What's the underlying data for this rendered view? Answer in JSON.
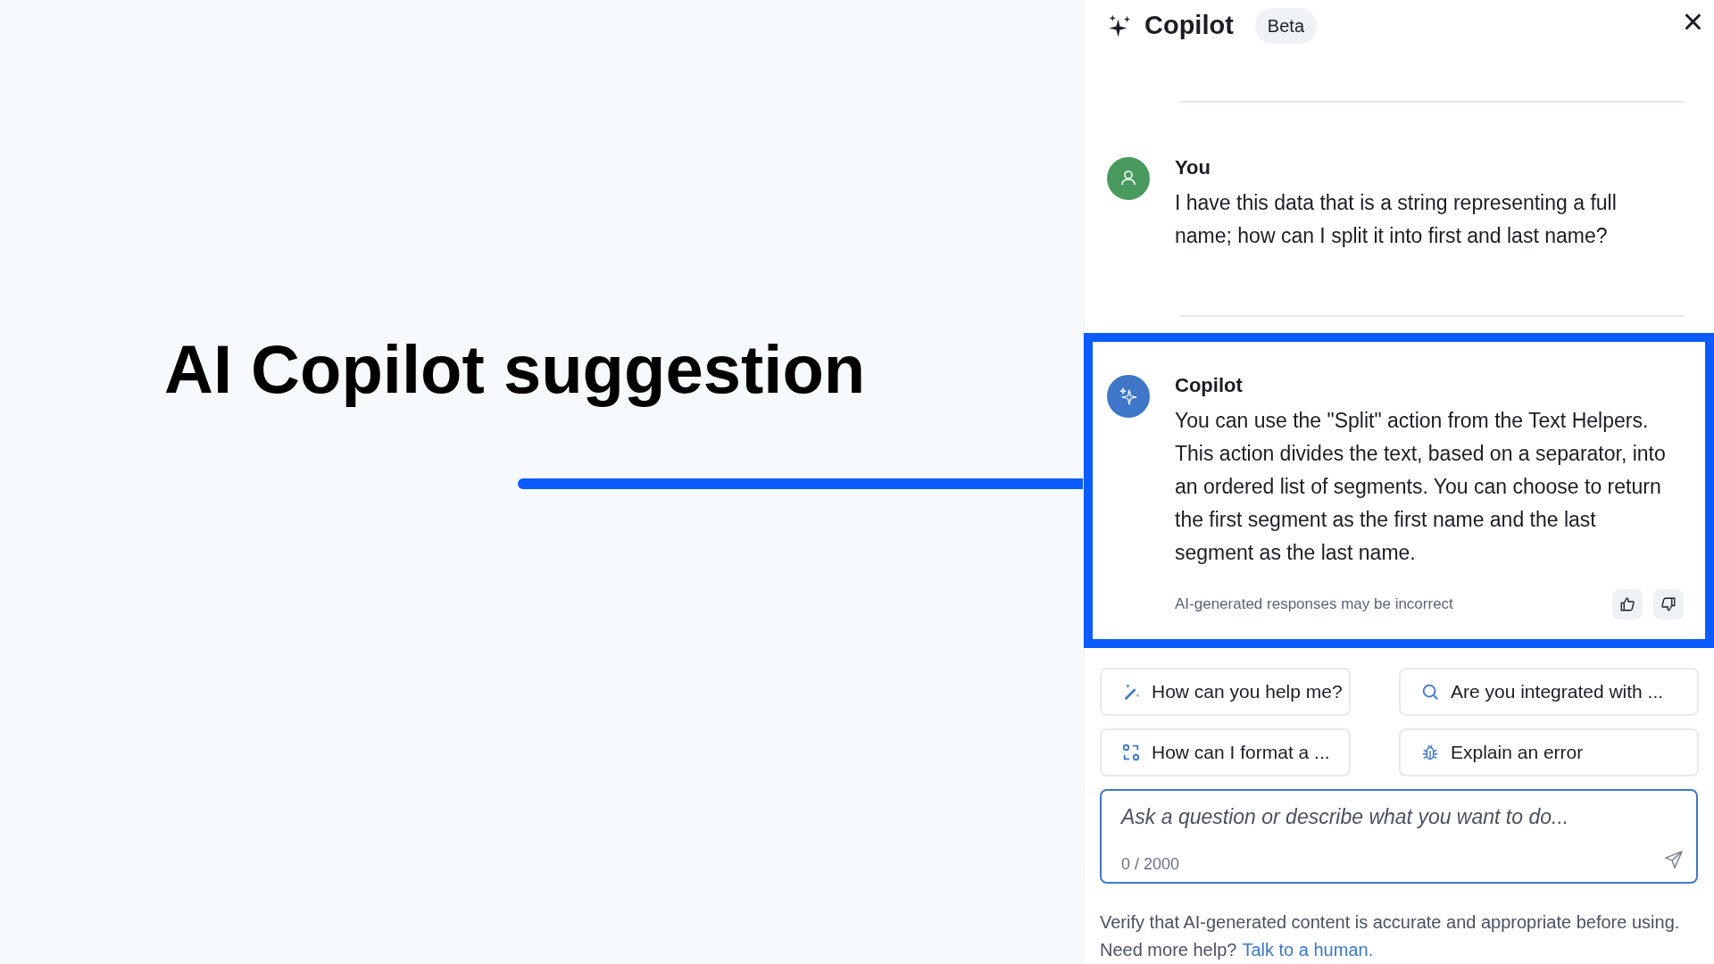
{
  "annotation": {
    "heading": "AI Copilot suggestion"
  },
  "panel": {
    "title": "Copilot",
    "badge": "Beta",
    "close": "×"
  },
  "messages": [
    {
      "kind": "user",
      "author": "You",
      "text": "I have this data that is a string representing a full name; how can I split it into first and last name?",
      "highlighted": false
    },
    {
      "kind": "assistant",
      "author": "Copilot",
      "text": "You can use the \"Split\" action from the Text Helpers. This action divides the text, based on a separator, into an ordered list of segments. You can choose to return the first segment as the first name and the last segment as the last name.",
      "highlighted": true,
      "disclaimer": "AI-generated responses may be incorrect"
    }
  ],
  "suggestions": [
    {
      "label": "How can you help me?"
    },
    {
      "label": "Are you integrated with ..."
    },
    {
      "label": "How can I format a ..."
    },
    {
      "label": "Explain an error"
    }
  ],
  "input": {
    "placeholder": "Ask a question or describe what you want to do...",
    "counter": "0 / 2000"
  },
  "footer": {
    "note": "Verify that AI-generated content is accurate and appropriate before using.",
    "help": "Need more help?",
    "link": "Talk to a human."
  }
}
